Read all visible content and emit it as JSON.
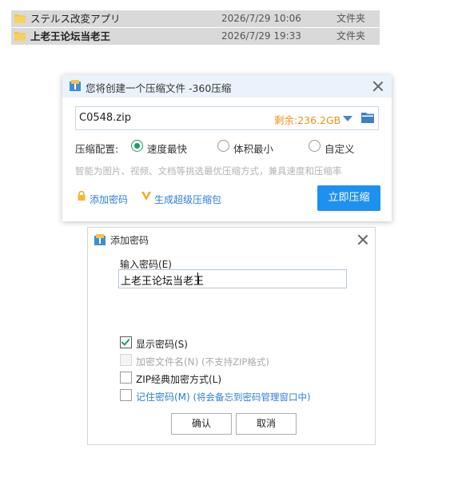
{
  "explorer": {
    "files": [
      {
        "name": "ステルス改変アプリ",
        "date": "2026/7/29 10:06",
        "type": "文件夹"
      },
      {
        "name": "上老王论坛当老王",
        "date": "2026/7/29 19:33",
        "type": "文件夹"
      }
    ]
  },
  "compress_dialog": {
    "title": "您将创建一个压缩文件 -360压缩",
    "filename": "C0548.zip",
    "space_remaining": "剩余:236.2GB",
    "config_label": "压缩配置:",
    "options": [
      "速度最快",
      "体积最小",
      "自定义"
    ],
    "selected_option": "速度最快",
    "hint": "智能为图片、视频、文档等挑选最优压缩方式，兼具速度和压缩率",
    "add_password_link": "添加密码",
    "super_package_link": "生成超级压缩包",
    "compress_button": "立即压缩",
    "colors": {
      "accent": "#1e90f0",
      "space_text": "#f0921a",
      "link": "#2f7fd8",
      "radio": "#1a9e63"
    },
    "icons": {
      "app": "360zip-app-icon",
      "folder": "browse-folder-icon",
      "lock": "lock-icon",
      "super": "v-badge-icon"
    }
  },
  "password_dialog": {
    "title": "添加密码",
    "input_label": "输入密码(E)",
    "input_value": "上老王论坛当老王",
    "show_password": {
      "label": "显示密码(S)",
      "checked": true
    },
    "encrypt_filenames": {
      "label": "加密文件名(N)",
      "note": "(不支持ZIP格式)",
      "disabled": true
    },
    "zip_classic": {
      "label": "ZIP经典加密方式(L)",
      "checked": false
    },
    "remember_password": {
      "label": "记住密码(M)",
      "note": "(将会备忘到密码管理窗口中)",
      "checked": false
    },
    "ok_button": "确认",
    "cancel_button": "取消"
  }
}
